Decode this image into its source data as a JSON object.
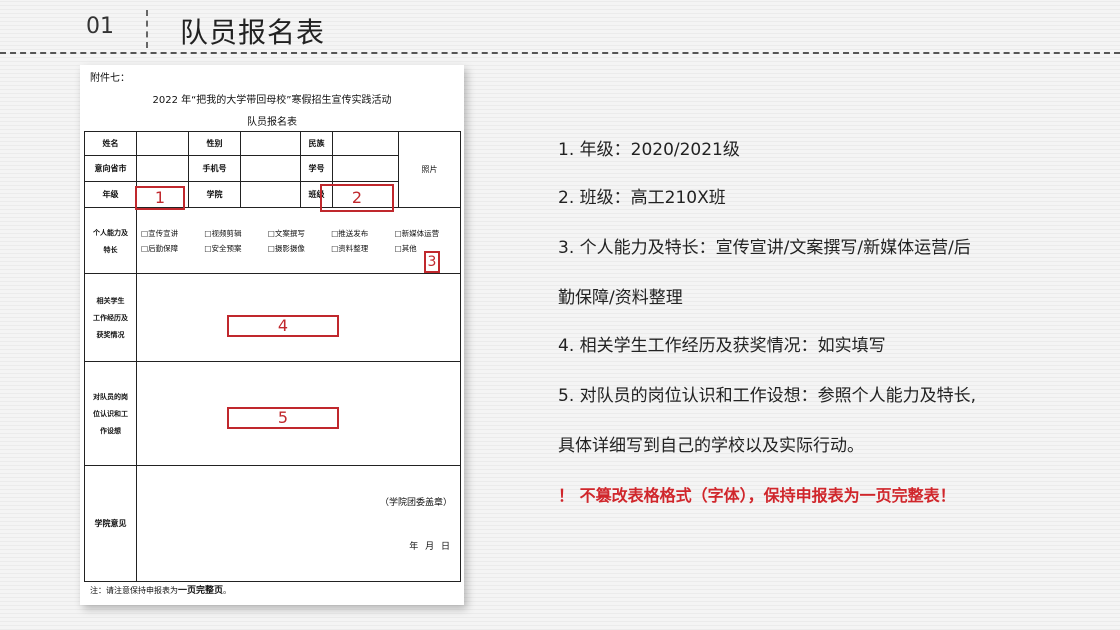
{
  "header": {
    "number": "01",
    "title": "队员报名表"
  },
  "document": {
    "attachment": "附件七：",
    "title": "2022 年“把我的大学带回母校”寒假招生宣传实践活动",
    "subtitle": "队员报名表",
    "row1": {
      "name": "姓名",
      "gender": "性别",
      "ethnicity": "民族"
    },
    "row2": {
      "province": "意向省市",
      "phone": "手机号",
      "student_id": "学号",
      "photo": "照片"
    },
    "row3": {
      "grade": "年级",
      "school": "学院",
      "class": "班级"
    },
    "ability_label": [
      "个人能力及",
      "特长"
    ],
    "ability_options": [
      "宣传宣讲",
      "视频剪辑",
      "文案撰写",
      "推送发布",
      "新媒体运营",
      "后勤保障",
      "安全预案",
      "摄影摄像",
      "资料整理",
      "其他"
    ],
    "experience_label": [
      "相关学生",
      "工作经历及",
      "获奖情况"
    ],
    "position_label": [
      "对队员的岗",
      "位认识和工",
      "作设想"
    ],
    "college_opinion": "学院意见",
    "seal": "（学院团委盖章）",
    "date": "年 月 日",
    "footer_note_prefix": "注：请注意保持申报表为",
    "footer_note_bold": "一页完整页",
    "footer_note_suffix": "。"
  },
  "markers": {
    "m1": "1",
    "m2": "2",
    "m3": "3",
    "m4": "4",
    "m5": "5"
  },
  "instructions": [
    "1. 年级：2020/2021级",
    "2. 班级：高工210X班",
    "3. 个人能力及特长：宣传宣讲/文案撰写/新媒体运营/后",
    "勤保障/资料整理",
    "4. 相关学生工作经历及获奖情况：如实填写",
    "5. 对队员的岗位认识和工作设想：参照个人能力及特长,",
    "具体详细写到自己的学校以及实际行动。"
  ],
  "warning": "！ 不篡改表格格式（字体），保持申报表为一页完整表！",
  "colors": {
    "accent_red": "#c0282d",
    "warning_red": "#d0262b"
  }
}
